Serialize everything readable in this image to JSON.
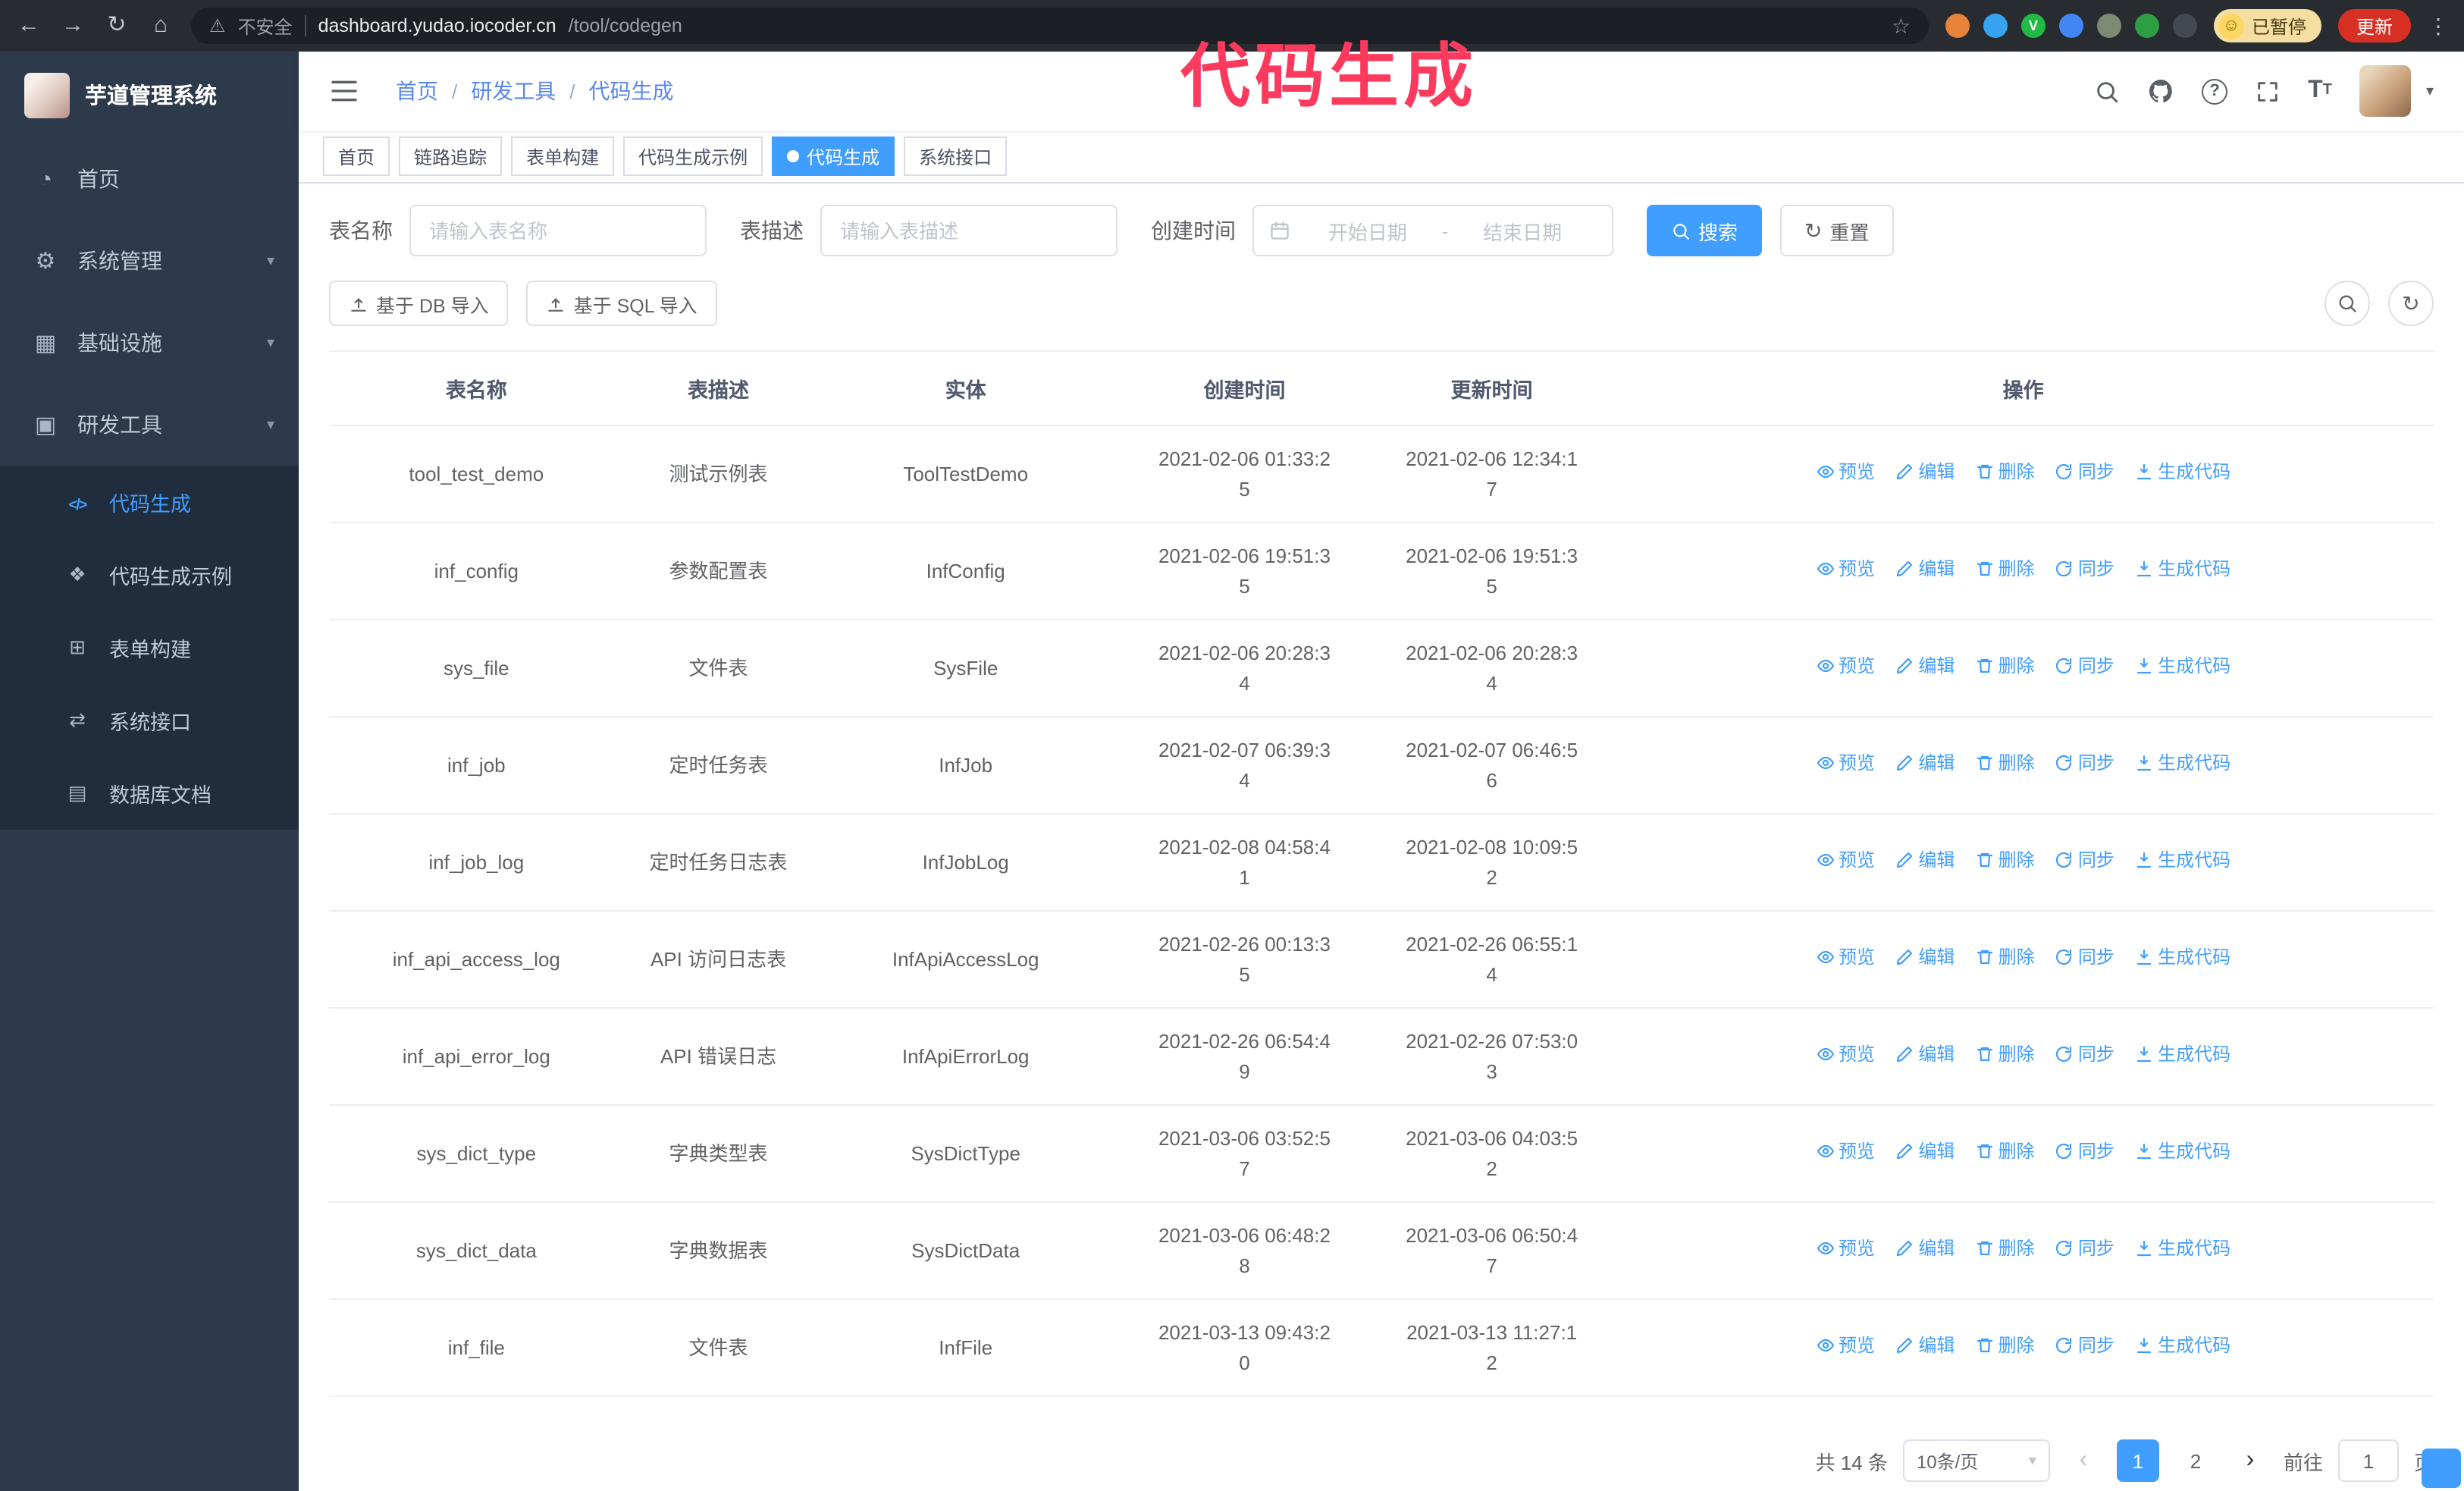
{
  "colors": {
    "primary": "#409eff",
    "sidebar_bg": "#2d3a4b",
    "submenu_bg": "#1f2d3d",
    "annotation": "#fb3a5d",
    "update_button_bg": "#d93025",
    "paused_badge_bg": "#f4dea2"
  },
  "browser": {
    "security_warning": "不安全",
    "url_host": "dashboard.yudao.iocoder.cn",
    "url_path": "/tool/codegen",
    "paused_badge": "已暂停",
    "update_button": "更新",
    "extensions": [
      {
        "color": "#e8833a",
        "glyph": ""
      },
      {
        "color": "#35a3f0",
        "glyph": ""
      },
      {
        "color": "#21ba45",
        "glyph": "V"
      },
      {
        "color": "#4285f4",
        "glyph": ""
      },
      {
        "color": "#7c8a74",
        "glyph": ""
      },
      {
        "color": "#2e9e44",
        "glyph": ""
      },
      {
        "color": "#44494f",
        "glyph": ""
      }
    ]
  },
  "annotation": {
    "title": "代码生成"
  },
  "sidebar": {
    "logo_title": "芋道管理系统",
    "items": [
      {
        "label": "首页",
        "icon": "dashboard-icon"
      },
      {
        "label": "系统管理",
        "icon": "gear-icon",
        "arrow": "down"
      },
      {
        "label": "基础设施",
        "icon": "infra-icon",
        "arrow": "down"
      },
      {
        "label": "研发工具",
        "icon": "tools-icon",
        "arrow": "up",
        "open": true
      }
    ],
    "sub_items": [
      {
        "label": "代码生成",
        "icon": "code-icon",
        "active": true
      },
      {
        "label": "代码生成示例",
        "icon": "example-icon"
      },
      {
        "label": "表单构建",
        "icon": "form-icon"
      },
      {
        "label": "系统接口",
        "icon": "api-icon"
      },
      {
        "label": "数据库文档",
        "icon": "db-doc-icon"
      }
    ]
  },
  "header": {
    "breadcrumb": [
      "首页",
      "研发工具",
      "代码生成"
    ],
    "breadcrumb_separator": "/"
  },
  "tabs": [
    {
      "label": "首页",
      "closable": false,
      "active": false
    },
    {
      "label": "链路追踪",
      "closable": true,
      "active": false
    },
    {
      "label": "表单构建",
      "closable": true,
      "active": false
    },
    {
      "label": "代码生成示例",
      "closable": true,
      "active": false
    },
    {
      "label": "代码生成",
      "closable": true,
      "active": true
    },
    {
      "label": "系统接口",
      "closable": true,
      "active": false
    }
  ],
  "filters": {
    "table_name_label": "表名称",
    "table_name_placeholder": "请输入表名称",
    "table_desc_label": "表描述",
    "table_desc_placeholder": "请输入表描述",
    "create_time_label": "创建时间",
    "date_start_placeholder": "开始日期",
    "date_separator": "-",
    "date_end_placeholder": "结束日期",
    "search_button": "搜索",
    "reset_button": "重置"
  },
  "toolbar": {
    "import_db_button": "基于 DB 导入",
    "import_sql_button": "基于 SQL 导入"
  },
  "table": {
    "columns": [
      "表名称",
      "表描述",
      "实体",
      "创建时间",
      "更新时间",
      "操作"
    ],
    "actions": [
      "预览",
      "编辑",
      "删除",
      "同步",
      "生成代码"
    ],
    "rows": [
      {
        "name": "tool_test_demo",
        "desc": "测试示例表",
        "entity": "ToolTestDemo",
        "created": "2021-02-06 01:33:25",
        "updated": "2021-02-06 12:34:17"
      },
      {
        "name": "inf_config",
        "desc": "参数配置表",
        "entity": "InfConfig",
        "created": "2021-02-06 19:51:35",
        "updated": "2021-02-06 19:51:35"
      },
      {
        "name": "sys_file",
        "desc": "文件表",
        "entity": "SysFile",
        "created": "2021-02-06 20:28:34",
        "updated": "2021-02-06 20:28:34"
      },
      {
        "name": "inf_job",
        "desc": "定时任务表",
        "entity": "InfJob",
        "created": "2021-02-07 06:39:34",
        "updated": "2021-02-07 06:46:56"
      },
      {
        "name": "inf_job_log",
        "desc": "定时任务日志表",
        "entity": "InfJobLog",
        "created": "2021-02-08 04:58:41",
        "updated": "2021-02-08 10:09:52"
      },
      {
        "name": "inf_api_access_log",
        "desc": "API 访问日志表",
        "entity": "InfApiAccessLog",
        "created": "2021-02-26 00:13:35",
        "updated": "2021-02-26 06:55:14"
      },
      {
        "name": "inf_api_error_log",
        "desc": "API 错误日志",
        "entity": "InfApiErrorLog",
        "created": "2021-02-26 06:54:49",
        "updated": "2021-02-26 07:53:03"
      },
      {
        "name": "sys_dict_type",
        "desc": "字典类型表",
        "entity": "SysDictType",
        "created": "2021-03-06 03:52:57",
        "updated": "2021-03-06 04:03:52"
      },
      {
        "name": "sys_dict_data",
        "desc": "字典数据表",
        "entity": "SysDictData",
        "created": "2021-03-06 06:48:28",
        "updated": "2021-03-06 06:50:47"
      },
      {
        "name": "inf_file",
        "desc": "文件表",
        "entity": "InfFile",
        "created": "2021-03-13 09:43:20",
        "updated": "2021-03-13 11:27:12"
      }
    ]
  },
  "pagination": {
    "total_text": "共 14 条",
    "page_size": "10条/页",
    "pages": [
      {
        "label": "1",
        "active": true
      },
      {
        "label": "2",
        "active": false
      }
    ],
    "goto_label": "前往",
    "goto_value": "1",
    "unit_label": "页"
  }
}
